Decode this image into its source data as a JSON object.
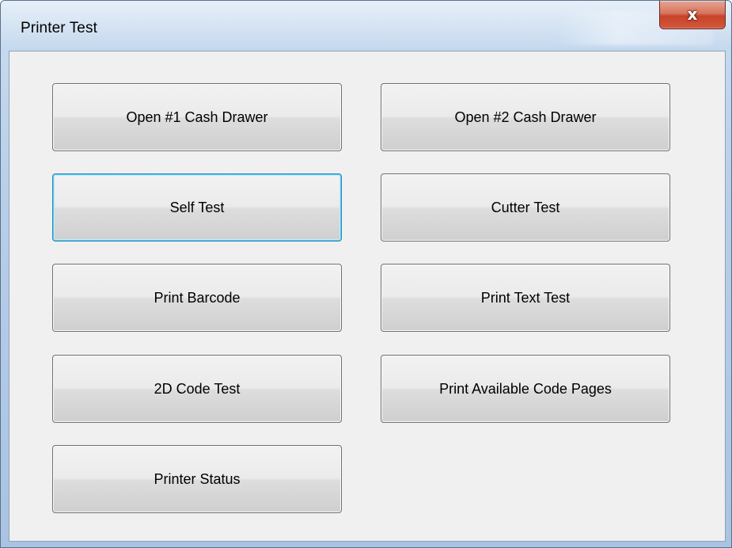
{
  "window": {
    "title": "Printer Test",
    "close_glyph": "x"
  },
  "buttons": {
    "open_drawer_1": "Open #1 Cash Drawer",
    "open_drawer_2": "Open #2 Cash Drawer",
    "self_test": "Self Test",
    "cutter_test": "Cutter Test",
    "print_barcode": "Print Barcode",
    "print_text_test": "Print Text Test",
    "code_2d_test": "2D Code Test",
    "print_code_pages": "Print Available Code Pages",
    "printer_status": "Printer Status"
  },
  "state": {
    "focused_button": "self_test"
  },
  "colors": {
    "client_background": "#f0f0f0",
    "focus_border": "#3c7fb1",
    "close_button": "#c7432a"
  }
}
